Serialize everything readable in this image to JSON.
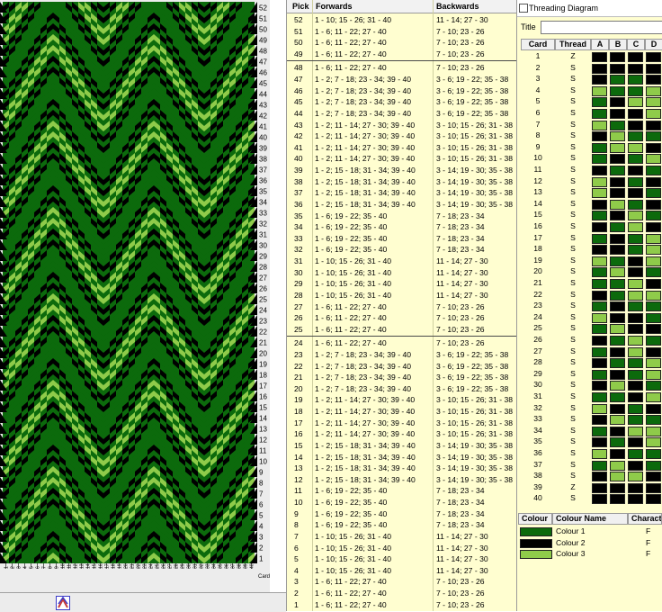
{
  "weave_panel": {
    "pick_labels": [
      "52",
      "51",
      "50",
      "49",
      "48",
      "47",
      "46",
      "45",
      "44",
      "43",
      "42",
      "41",
      "40",
      "39",
      "38",
      "37",
      "36",
      "35",
      "34",
      "33",
      "32",
      "31",
      "30",
      "29",
      "28",
      "27",
      "26",
      "25",
      "24",
      "23",
      "22",
      "21",
      "20",
      "19",
      "18",
      "17",
      "16",
      "15",
      "14",
      "13",
      "12",
      "11",
      "10",
      "9",
      "8",
      "7",
      "6",
      "5",
      "4",
      "3",
      "2",
      "1"
    ],
    "card_axis_label": "Card",
    "colors": {
      "dark": "#0c6a0c",
      "black": "#000000",
      "light": "#8fcb4a"
    }
  },
  "pick_table": {
    "headers": {
      "pick": "Pick",
      "forwards": "Forwards",
      "backwards": "Backwards"
    },
    "rows": [
      {
        "pick": "52",
        "fwd": "1 - 10; 15 - 26; 31 - 40",
        "bwd": "11 - 14; 27 - 30"
      },
      {
        "pick": "51",
        "fwd": "1 - 6; 11 - 22; 27 - 40",
        "bwd": "7 - 10; 23 - 26"
      },
      {
        "pick": "50",
        "fwd": "1 - 6; 11 - 22; 27 - 40",
        "bwd": "7 - 10; 23 - 26"
      },
      {
        "pick": "49",
        "fwd": "1 - 6; 11 - 22; 27 - 40",
        "bwd": "7 - 10; 23 - 26"
      },
      {
        "pick": "48",
        "fwd": "1 - 6; 11 - 22; 27 - 40",
        "bwd": "7 - 10; 23 - 26"
      },
      {
        "pick": "47",
        "fwd": "1 - 2; 7 - 18; 23 - 34; 39 - 40",
        "bwd": "3 - 6; 19 - 22; 35 - 38"
      },
      {
        "pick": "46",
        "fwd": "1 - 2; 7 - 18; 23 - 34; 39 - 40",
        "bwd": "3 - 6; 19 - 22; 35 - 38"
      },
      {
        "pick": "45",
        "fwd": "1 - 2; 7 - 18; 23 - 34; 39 - 40",
        "bwd": "3 - 6; 19 - 22; 35 - 38"
      },
      {
        "pick": "44",
        "fwd": "1 - 2; 7 - 18; 23 - 34; 39 - 40",
        "bwd": "3 - 6; 19 - 22; 35 - 38"
      },
      {
        "pick": "43",
        "fwd": "1 - 2; 11 - 14; 27 - 30; 39 - 40",
        "bwd": "3 - 10; 15 - 26; 31 - 38"
      },
      {
        "pick": "42",
        "fwd": "1 - 2; 11 - 14; 27 - 30; 39 - 40",
        "bwd": "3 - 10; 15 - 26; 31 - 38"
      },
      {
        "pick": "41",
        "fwd": "1 - 2; 11 - 14; 27 - 30; 39 - 40",
        "bwd": "3 - 10; 15 - 26; 31 - 38"
      },
      {
        "pick": "40",
        "fwd": "1 - 2; 11 - 14; 27 - 30; 39 - 40",
        "bwd": "3 - 10; 15 - 26; 31 - 38"
      },
      {
        "pick": "39",
        "fwd": "1 - 2; 15 - 18; 31 - 34; 39 - 40",
        "bwd": "3 - 14; 19 - 30; 35 - 38"
      },
      {
        "pick": "38",
        "fwd": "1 - 2; 15 - 18; 31 - 34; 39 - 40",
        "bwd": "3 - 14; 19 - 30; 35 - 38"
      },
      {
        "pick": "37",
        "fwd": "1 - 2; 15 - 18; 31 - 34; 39 - 40",
        "bwd": "3 - 14; 19 - 30; 35 - 38"
      },
      {
        "pick": "36",
        "fwd": "1 - 2; 15 - 18; 31 - 34; 39 - 40",
        "bwd": "3 - 14; 19 - 30; 35 - 38"
      },
      {
        "pick": "35",
        "fwd": "1 - 6; 19 - 22; 35 - 40",
        "bwd": "7 - 18; 23 - 34"
      },
      {
        "pick": "34",
        "fwd": "1 - 6; 19 - 22; 35 - 40",
        "bwd": "7 - 18; 23 - 34"
      },
      {
        "pick": "33",
        "fwd": "1 - 6; 19 - 22; 35 - 40",
        "bwd": "7 - 18; 23 - 34"
      },
      {
        "pick": "32",
        "fwd": "1 - 6; 19 - 22; 35 - 40",
        "bwd": "7 - 18; 23 - 34"
      },
      {
        "pick": "31",
        "fwd": "1 - 10; 15 - 26; 31 - 40",
        "bwd": "11 - 14; 27 - 30"
      },
      {
        "pick": "30",
        "fwd": "1 - 10; 15 - 26; 31 - 40",
        "bwd": "11 - 14; 27 - 30"
      },
      {
        "pick": "29",
        "fwd": "1 - 10; 15 - 26; 31 - 40",
        "bwd": "11 - 14; 27 - 30"
      },
      {
        "pick": "28",
        "fwd": "1 - 10; 15 - 26; 31 - 40",
        "bwd": "11 - 14; 27 - 30"
      },
      {
        "pick": "27",
        "fwd": "1 - 6; 11 - 22; 27 - 40",
        "bwd": "7 - 10; 23 - 26"
      },
      {
        "pick": "26",
        "fwd": "1 - 6; 11 - 22; 27 - 40",
        "bwd": "7 - 10; 23 - 26"
      },
      {
        "pick": "25",
        "fwd": "1 - 6; 11 - 22; 27 - 40",
        "bwd": "7 - 10; 23 - 26"
      },
      {
        "pick": "24",
        "fwd": "1 - 6; 11 - 22; 27 - 40",
        "bwd": "7 - 10; 23 - 26"
      },
      {
        "pick": "23",
        "fwd": "1 - 2; 7 - 18; 23 - 34; 39 - 40",
        "bwd": "3 - 6; 19 - 22; 35 - 38"
      },
      {
        "pick": "22",
        "fwd": "1 - 2; 7 - 18; 23 - 34; 39 - 40",
        "bwd": "3 - 6; 19 - 22; 35 - 38"
      },
      {
        "pick": "21",
        "fwd": "1 - 2; 7 - 18; 23 - 34; 39 - 40",
        "bwd": "3 - 6; 19 - 22; 35 - 38"
      },
      {
        "pick": "20",
        "fwd": "1 - 2; 7 - 18; 23 - 34; 39 - 40",
        "bwd": "3 - 6; 19 - 22; 35 - 38"
      },
      {
        "pick": "19",
        "fwd": "1 - 2; 11 - 14; 27 - 30; 39 - 40",
        "bwd": "3 - 10; 15 - 26; 31 - 38"
      },
      {
        "pick": "18",
        "fwd": "1 - 2; 11 - 14; 27 - 30; 39 - 40",
        "bwd": "3 - 10; 15 - 26; 31 - 38"
      },
      {
        "pick": "17",
        "fwd": "1 - 2; 11 - 14; 27 - 30; 39 - 40",
        "bwd": "3 - 10; 15 - 26; 31 - 38"
      },
      {
        "pick": "16",
        "fwd": "1 - 2; 11 - 14; 27 - 30; 39 - 40",
        "bwd": "3 - 10; 15 - 26; 31 - 38"
      },
      {
        "pick": "15",
        "fwd": "1 - 2; 15 - 18; 31 - 34; 39 - 40",
        "bwd": "3 - 14; 19 - 30; 35 - 38"
      },
      {
        "pick": "14",
        "fwd": "1 - 2; 15 - 18; 31 - 34; 39 - 40",
        "bwd": "3 - 14; 19 - 30; 35 - 38"
      },
      {
        "pick": "13",
        "fwd": "1 - 2; 15 - 18; 31 - 34; 39 - 40",
        "bwd": "3 - 14; 19 - 30; 35 - 38"
      },
      {
        "pick": "12",
        "fwd": "1 - 2; 15 - 18; 31 - 34; 39 - 40",
        "bwd": "3 - 14; 19 - 30; 35 - 38"
      },
      {
        "pick": "11",
        "fwd": "1 - 6; 19 - 22; 35 - 40",
        "bwd": "7 - 18; 23 - 34"
      },
      {
        "pick": "10",
        "fwd": "1 - 6; 19 - 22; 35 - 40",
        "bwd": "7 - 18; 23 - 34"
      },
      {
        "pick": "9",
        "fwd": "1 - 6; 19 - 22; 35 - 40",
        "bwd": "7 - 18; 23 - 34"
      },
      {
        "pick": "8",
        "fwd": "1 - 6; 19 - 22; 35 - 40",
        "bwd": "7 - 18; 23 - 34"
      },
      {
        "pick": "7",
        "fwd": "1 - 10; 15 - 26; 31 - 40",
        "bwd": "11 - 14; 27 - 30"
      },
      {
        "pick": "6",
        "fwd": "1 - 10; 15 - 26; 31 - 40",
        "bwd": "11 - 14; 27 - 30"
      },
      {
        "pick": "5",
        "fwd": "1 - 10; 15 - 26; 31 - 40",
        "bwd": "11 - 14; 27 - 30"
      },
      {
        "pick": "4",
        "fwd": "1 - 10; 15 - 26; 31 - 40",
        "bwd": "11 - 14; 27 - 30"
      },
      {
        "pick": "3",
        "fwd": "1 - 6; 11 - 22; 27 - 40",
        "bwd": "7 - 10; 23 - 26"
      },
      {
        "pick": "2",
        "fwd": "1 - 6; 11 - 22; 27 - 40",
        "bwd": "7 - 10; 23 - 26"
      },
      {
        "pick": "1",
        "fwd": "1 - 6; 11 - 22; 27 - 40",
        "bwd": "7 - 10; 23 - 26"
      }
    ]
  },
  "threading": {
    "window_title": "Threading Diagram",
    "title_label": "Title",
    "title_value": "",
    "headers": {
      "card": "Card",
      "thread": "Thread",
      "a": "A",
      "b": "B",
      "c": "C",
      "d": "D"
    },
    "palette": {
      "1": "#0c6a0c",
      "2": "#000000",
      "3": "#8fcb4a"
    },
    "cards": [
      {
        "card": "1",
        "thread": "Z",
        "holes": [
          2,
          2,
          2,
          2
        ]
      },
      {
        "card": "2",
        "thread": "S",
        "holes": [
          2,
          2,
          2,
          2
        ]
      },
      {
        "card": "3",
        "thread": "S",
        "holes": [
          2,
          1,
          1,
          2
        ]
      },
      {
        "card": "4",
        "thread": "S",
        "holes": [
          3,
          1,
          1,
          3
        ]
      },
      {
        "card": "5",
        "thread": "S",
        "holes": [
          1,
          2,
          3,
          3
        ]
      },
      {
        "card": "6",
        "thread": "S",
        "holes": [
          1,
          2,
          2,
          3
        ]
      },
      {
        "card": "7",
        "thread": "S",
        "holes": [
          3,
          1,
          2,
          2
        ]
      },
      {
        "card": "8",
        "thread": "S",
        "holes": [
          2,
          3,
          1,
          1
        ]
      },
      {
        "card": "9",
        "thread": "S",
        "holes": [
          1,
          3,
          3,
          2
        ]
      },
      {
        "card": "10",
        "thread": "S",
        "holes": [
          1,
          2,
          1,
          3
        ]
      },
      {
        "card": "11",
        "thread": "S",
        "holes": [
          2,
          1,
          2,
          1
        ]
      },
      {
        "card": "12",
        "thread": "S",
        "holes": [
          3,
          2,
          1,
          2
        ]
      },
      {
        "card": "13",
        "thread": "S",
        "holes": [
          3,
          2,
          2,
          1
        ]
      },
      {
        "card": "14",
        "thread": "S",
        "holes": [
          2,
          3,
          1,
          2
        ]
      },
      {
        "card": "15",
        "thread": "S",
        "holes": [
          1,
          2,
          3,
          1
        ]
      },
      {
        "card": "16",
        "thread": "S",
        "holes": [
          2,
          1,
          3,
          2
        ]
      },
      {
        "card": "17",
        "thread": "S",
        "holes": [
          1,
          2,
          1,
          3
        ]
      },
      {
        "card": "18",
        "thread": "S",
        "holes": [
          2,
          2,
          1,
          3
        ]
      },
      {
        "card": "19",
        "thread": "S",
        "holes": [
          3,
          1,
          2,
          3
        ]
      },
      {
        "card": "20",
        "thread": "S",
        "holes": [
          1,
          3,
          2,
          1
        ]
      },
      {
        "card": "21",
        "thread": "S",
        "holes": [
          1,
          1,
          3,
          2
        ]
      },
      {
        "card": "22",
        "thread": "S",
        "holes": [
          2,
          1,
          3,
          3
        ]
      },
      {
        "card": "23",
        "thread": "S",
        "holes": [
          1,
          2,
          1,
          1
        ]
      },
      {
        "card": "24",
        "thread": "S",
        "holes": [
          3,
          2,
          2,
          1
        ]
      },
      {
        "card": "25",
        "thread": "S",
        "holes": [
          1,
          3,
          2,
          2
        ]
      },
      {
        "card": "26",
        "thread": "S",
        "holes": [
          2,
          1,
          3,
          1
        ]
      },
      {
        "card": "27",
        "thread": "S",
        "holes": [
          1,
          2,
          3,
          2
        ]
      },
      {
        "card": "28",
        "thread": "S",
        "holes": [
          2,
          1,
          1,
          3
        ]
      },
      {
        "card": "29",
        "thread": "S",
        "holes": [
          1,
          2,
          1,
          3
        ]
      },
      {
        "card": "30",
        "thread": "S",
        "holes": [
          2,
          3,
          2,
          1
        ]
      },
      {
        "card": "31",
        "thread": "S",
        "holes": [
          1,
          1,
          2,
          3
        ]
      },
      {
        "card": "32",
        "thread": "S",
        "holes": [
          3,
          2,
          1,
          2
        ]
      },
      {
        "card": "33",
        "thread": "S",
        "holes": [
          2,
          3,
          1,
          1
        ]
      },
      {
        "card": "34",
        "thread": "S",
        "holes": [
          1,
          2,
          3,
          3
        ]
      },
      {
        "card": "35",
        "thread": "S",
        "holes": [
          2,
          1,
          2,
          3
        ]
      },
      {
        "card": "36",
        "thread": "S",
        "holes": [
          3,
          2,
          1,
          1
        ]
      },
      {
        "card": "37",
        "thread": "S",
        "holes": [
          1,
          3,
          2,
          1
        ]
      },
      {
        "card": "38",
        "thread": "S",
        "holes": [
          2,
          3,
          3,
          2
        ]
      },
      {
        "card": "39",
        "thread": "Z",
        "holes": [
          2,
          2,
          2,
          2
        ]
      },
      {
        "card": "40",
        "thread": "S",
        "holes": [
          2,
          2,
          2,
          2
        ]
      }
    ]
  },
  "colour_table": {
    "headers": {
      "colour": "Colour",
      "name": "Colour Name",
      "character": "Characte"
    },
    "rows": [
      {
        "color": "#0c6a0c",
        "name": "Colour 1",
        "character": "F"
      },
      {
        "color": "#000000",
        "name": "Colour 2",
        "character": "F"
      },
      {
        "color": "#8fcb4a",
        "name": "Colour 3",
        "character": "F"
      }
    ]
  }
}
